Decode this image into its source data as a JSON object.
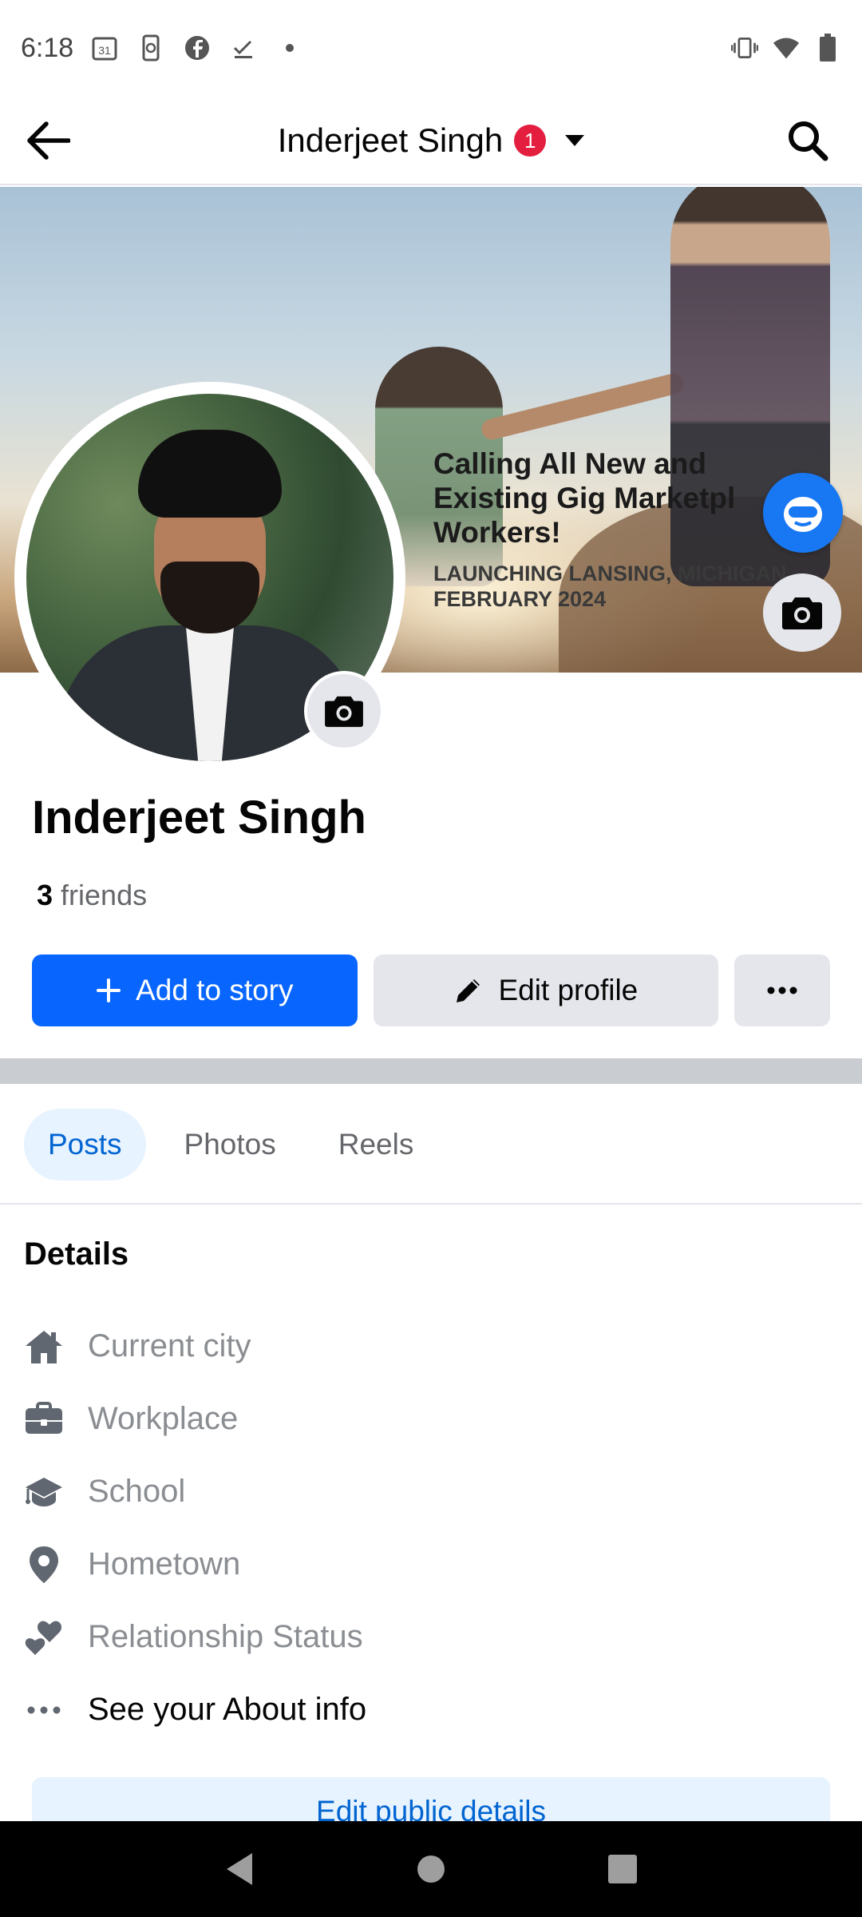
{
  "status_bar": {
    "time": "6:18",
    "icons": [
      "calendar-icon",
      "phone-sync-icon",
      "facebook-icon",
      "task-done-icon",
      "dot-icon"
    ],
    "right_icons": [
      "vibrate-icon",
      "wifi-icon",
      "battery-icon"
    ],
    "calendar_day": "31"
  },
  "header": {
    "title": "Inderjeet Singh",
    "badge_count": "1"
  },
  "cover": {
    "headline": "Calling All New and\nExisting Gig Marketpl\nWorkers!",
    "subline": "LAUNCHING LANSING, MICHIGAN\nFEBRUARY 2024"
  },
  "profile": {
    "name": "Inderjeet Singh",
    "friends_count": "3",
    "friends_label": "friends"
  },
  "actions": {
    "add_story": "Add to story",
    "edit_profile": "Edit profile",
    "more": "···"
  },
  "tabs": [
    {
      "label": "Posts",
      "active": true
    },
    {
      "label": "Photos",
      "active": false
    },
    {
      "label": "Reels",
      "active": false
    }
  ],
  "details": {
    "title": "Details",
    "items": [
      {
        "label": "Current city",
        "icon": "home-icon"
      },
      {
        "label": "Workplace",
        "icon": "briefcase-icon"
      },
      {
        "label": "School",
        "icon": "graduation-cap-icon"
      },
      {
        "label": "Hometown",
        "icon": "location-pin-icon"
      },
      {
        "label": "Relationship Status",
        "icon": "hearts-icon"
      },
      {
        "label": "See your About info",
        "icon": "more-dots-icon"
      }
    ],
    "edit_public": "Edit public details"
  },
  "colors": {
    "primary": "#0866ff",
    "badge": "#e41e3f",
    "tab_active_bg": "#e7f3ff",
    "tab_active_text": "#0064d1"
  }
}
